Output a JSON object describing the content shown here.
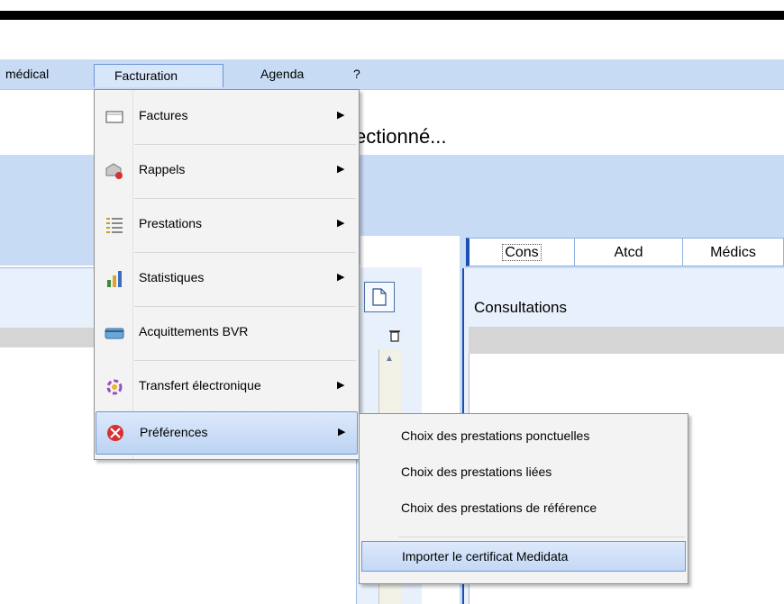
{
  "menubar": {
    "items": [
      {
        "label": "médical"
      },
      {
        "label": "Facturation"
      },
      {
        "label": "Agenda"
      },
      {
        "label": "?"
      }
    ]
  },
  "header": {
    "selected_title": "ectionné..."
  },
  "tabs": [
    {
      "label": "Cons"
    },
    {
      "label": "Atcd"
    },
    {
      "label": "Médics"
    }
  ],
  "right_panel": {
    "title": "Consultations"
  },
  "facturation_menu": {
    "items": [
      {
        "label": "Factures",
        "icon": "invoice-icon",
        "has_submenu": true
      },
      {
        "label": "Rappels",
        "icon": "reminder-envelope-icon",
        "has_submenu": true
      },
      {
        "label": "Prestations",
        "icon": "list-icon",
        "has_submenu": true
      },
      {
        "label": "Statistiques",
        "icon": "statistics-icon",
        "has_submenu": true
      },
      {
        "label": "Acquittements BVR",
        "icon": "payment-card-icon",
        "has_submenu": false
      },
      {
        "label": "Transfert électronique",
        "icon": "transfer-icon",
        "has_submenu": true
      },
      {
        "label": "Préférences",
        "icon": "preferences-tools-icon",
        "has_submenu": true
      }
    ],
    "highlighted": "Préférences"
  },
  "preferences_submenu": {
    "items": [
      {
        "label": "Choix des prestations ponctuelles"
      },
      {
        "label": "Choix des prestations liées"
      },
      {
        "label": "Choix des prestations de référence"
      },
      {
        "label": "Importer le certificat Medidata"
      }
    ],
    "highlighted": "Importer le certificat Medidata"
  },
  "colors": {
    "menubar_bg": "#c8dbf5",
    "accent": "#1c4fb0",
    "highlight_border": "#6d95d3"
  }
}
